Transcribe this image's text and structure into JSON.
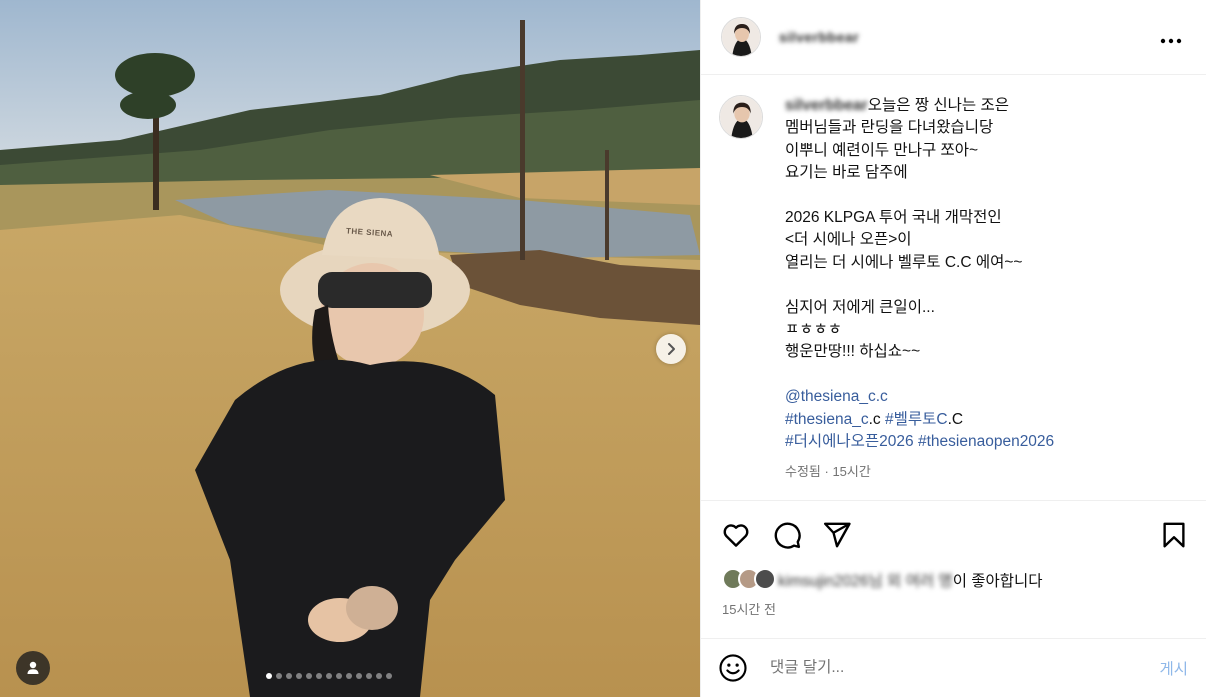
{
  "post": {
    "username": "silverbbear",
    "more_icon": "more-horizontal-icon"
  },
  "photo": {
    "hat_text": "THE SIENA",
    "next_icon": "chevron-right-icon",
    "tag_icon": "user-tag-icon",
    "carousel_total": 13,
    "carousel_current": 1
  },
  "caption": {
    "user": "silverbbear",
    "lines": [
      "오늘은 짱 신나는 조은",
      "멤버님들과 란딩을 다녀왔습니당",
      "이뿌니 예련이두 만나구 쪼아~",
      "요기는 바로 담주에",
      "",
      "2026 KLPGA 투어 국내 개막전인",
      "<더 시에나 오픈>이",
      "열리는 더 시에나 벨루토 C.C 에여~~",
      "",
      "심지어 저에게 큰일이...",
      "ㅍㅎㅎㅎ",
      "행운만땅!!! 하십쇼~~",
      ""
    ],
    "mention": "@thesiena_c.c",
    "tags_line1": [
      {
        "text": "#thesiena_c",
        "link": true
      },
      {
        "text": ".c ",
        "link": false
      },
      {
        "text": "#벨루토C",
        "link": true
      },
      {
        "text": ".C",
        "link": false
      }
    ],
    "tags_line2": [
      {
        "text": "#더시에나오픈2026",
        "link": true
      },
      {
        "text": " ",
        "link": false
      },
      {
        "text": "#thesienaopen2026",
        "link": true
      }
    ],
    "edited": "수정됨",
    "separator": " · ",
    "time": "15시간"
  },
  "actions": {
    "like_icon": "heart-icon",
    "comment_icon": "comment-icon",
    "share_icon": "send-icon",
    "save_icon": "bookmark-icon"
  },
  "likes": {
    "users_blurred": "kimsujin2026님 외 여러 명",
    "suffix": "이 좋아합니다",
    "time": "15시간 전"
  },
  "comment": {
    "emoji_icon": "emoji-smile-icon",
    "placeholder": "댓글 달기...",
    "post_label": "게시"
  },
  "colors": {
    "link": "#385d9c",
    "post_button": "#8fb8e9",
    "muted": "#737373",
    "border": "#efefef"
  }
}
